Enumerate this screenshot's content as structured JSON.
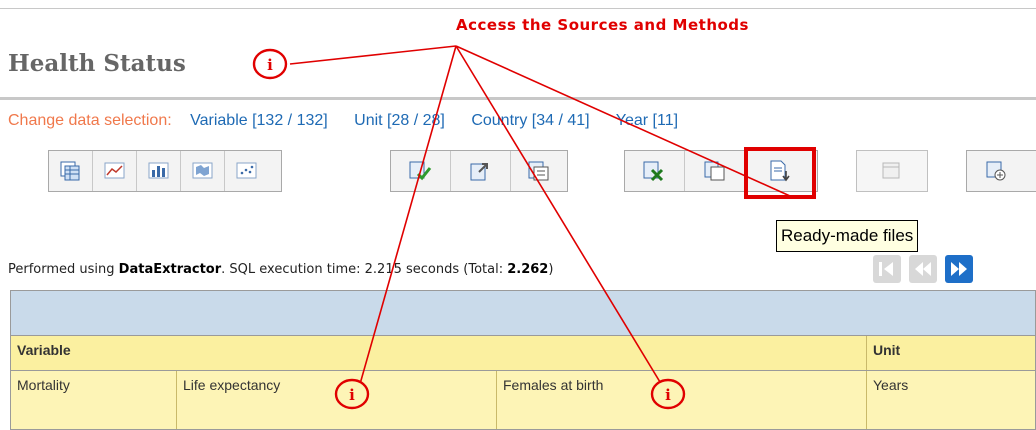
{
  "page": {
    "title": "Health Status"
  },
  "annotation": {
    "text": "Access the Sources and Methods"
  },
  "selection": {
    "label": "Change data selection:",
    "links": [
      "Variable [132 / 132]",
      "Unit [28 / 28]",
      "Country [34 / 41]",
      "Year [11]"
    ]
  },
  "toolbar": {
    "tooltip": "Ready-made files",
    "buttons": [
      "table-view-icon",
      "line-chart-icon",
      "bar-chart-icon",
      "map-icon",
      "scatter-plot-icon",
      "validate-icon",
      "export-icon",
      "list-icon",
      "excel-export-icon",
      "copy-icon",
      "ready-made-files-icon",
      "window-icon",
      "add-table-icon"
    ]
  },
  "execution": {
    "prefix": "Performed using ",
    "tool": "DataExtractor",
    "middle": ". SQL execution time: 2.215 seconds (Total: ",
    "total": "2.262",
    "suffix": ")"
  },
  "pager": {
    "buttons": [
      "first-page-icon",
      "previous-page-icon",
      "next-page-icon"
    ]
  },
  "table": {
    "headers": {
      "variable": "Variable",
      "unit": "Unit"
    },
    "row": {
      "category": "Mortality",
      "variable": "Life expectancy",
      "detail": "Females at birth",
      "unit": "Years"
    }
  },
  "colors": {
    "annotation_red": "#e00000",
    "link_blue": "#1e6ab4",
    "selection_label_orange": "#f0784b",
    "header_band_blue": "#c9daea",
    "header_yellow": "#fbf0a0",
    "row_yellow": "#fdf4b6"
  }
}
